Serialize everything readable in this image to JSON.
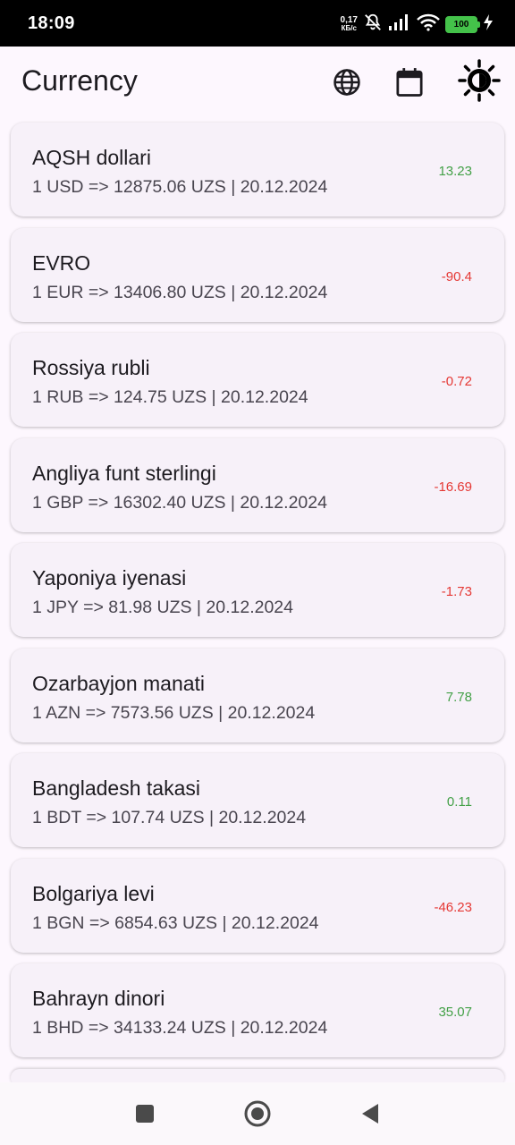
{
  "status_bar": {
    "time": "18:09",
    "net_speed_value": "0,17",
    "net_speed_unit": "КБ/с",
    "battery": "100"
  },
  "app_bar": {
    "title": "Currency",
    "icons": [
      "globe-icon",
      "calendar-icon",
      "brightness-icon"
    ]
  },
  "colors": {
    "positive": "#43a047",
    "negative": "#e53935"
  },
  "currencies": [
    {
      "name": "AQSH dollari",
      "rate": "1 USD => 12875.06 UZS | 20.12.2024",
      "change": "13.23",
      "trend": "up"
    },
    {
      "name": "EVRO",
      "rate": "1 EUR => 13406.80 UZS | 20.12.2024",
      "change": "-90.4",
      "trend": "down"
    },
    {
      "name": "Rossiya rubli",
      "rate": "1 RUB => 124.75 UZS | 20.12.2024",
      "change": "-0.72",
      "trend": "down"
    },
    {
      "name": "Angliya funt sterlingi",
      "rate": "1 GBP => 16302.40 UZS | 20.12.2024",
      "change": "-16.69",
      "trend": "down"
    },
    {
      "name": "Yaponiya iyenasi",
      "rate": "1 JPY => 81.98 UZS | 20.12.2024",
      "change": "-1.73",
      "trend": "down"
    },
    {
      "name": "Ozarbayjon manati",
      "rate": "1 AZN => 7573.56 UZS | 20.12.2024",
      "change": "7.78",
      "trend": "up"
    },
    {
      "name": "Bangladesh takasi",
      "rate": "1 BDT => 107.74 UZS | 20.12.2024",
      "change": "0.11",
      "trend": "up"
    },
    {
      "name": "Bolgariya levi",
      "rate": "1 BGN => 6854.63 UZS | 20.12.2024",
      "change": "-46.23",
      "trend": "down"
    },
    {
      "name": "Bahrayn dinori",
      "rate": "1 BHD => 34133.24 UZS | 20.12.2024",
      "change": "35.07",
      "trend": "up"
    }
  ],
  "nav_bar": {
    "buttons": [
      "recents-button",
      "home-button",
      "back-button"
    ]
  }
}
